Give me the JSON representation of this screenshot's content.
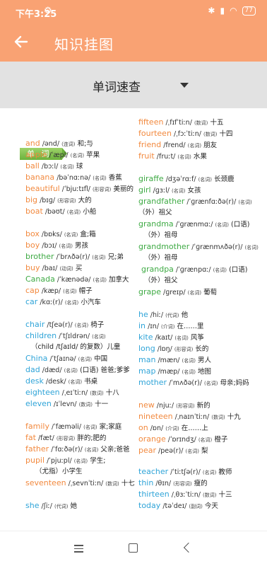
{
  "status": {
    "time": "下午3:25",
    "battery": "77"
  },
  "appbar": {
    "title": "知识挂图"
  },
  "selector": {
    "label": "单词速查"
  },
  "section_tag": "单 词",
  "columns": [
    [
      {
        "word": "and",
        "phon": "/ənd/",
        "pos": "(连词)",
        "meaning": "和;与",
        "color": "orange"
      },
      {
        "word": "apple",
        "phon": "/ˈæpl/",
        "pos": "(名词)",
        "meaning": "苹果",
        "color": "orange"
      },
      {
        "word": "ball",
        "phon": "/bɔːl/",
        "pos": "(名词)",
        "meaning": "球",
        "color": "orange"
      },
      {
        "word": "banana",
        "phon": "/bəˈnɑːnə/",
        "pos": "(名词)",
        "meaning": "香蕉",
        "color": "orange"
      },
      {
        "word": "beautiful",
        "phon": "/ˈbjuːtɪfl/",
        "pos": "(形容词)",
        "meaning": "美丽的",
        "color": "orange"
      },
      {
        "word": "big",
        "phon": "/bɪɡ/",
        "pos": "(形容词)",
        "meaning": "大的",
        "color": "orange"
      },
      {
        "word": "boat",
        "phon": "/bəʊt/",
        "pos": "(名词)",
        "meaning": "小船",
        "color": "orange"
      },
      {
        "word": "box",
        "phon": "/bɒks/",
        "pos": "(名词)",
        "meaning": "盒;箱",
        "color": "orange"
      },
      {
        "word": "boy",
        "phon": "/bɔɪ/",
        "pos": "(名词)",
        "meaning": "男孩",
        "color": "orange"
      },
      {
        "word": "brother",
        "phon": "/ˈbrʌðə(r)/",
        "pos": "(名词)",
        "meaning": "兄;弟",
        "color": "green"
      },
      {
        "word": "buy",
        "phon": "/baɪ/",
        "pos": "(动词)",
        "meaning": "买",
        "color": "orange"
      },
      {
        "word": "Canada",
        "phon": "/ˈkænədə/",
        "pos": "(名词)",
        "meaning": "加拿大",
        "color": "green"
      },
      {
        "word": "cap",
        "phon": "/kæp/",
        "pos": "(名词)",
        "meaning": "帽子",
        "color": "orange"
      },
      {
        "word": "car",
        "phon": "/kɑː(r)/",
        "pos": "(名词)",
        "meaning": "小汽车",
        "color": "blue"
      },
      {
        "word": "chair",
        "phon": "/tʃeə(r)/",
        "pos": "(名词)",
        "meaning": "椅子",
        "color": "blue"
      },
      {
        "word": "children",
        "phon": "/ˈtʃɪldrən/",
        "pos": "(名词)",
        "meaning": "",
        "color": "blue"
      },
      {
        "word": "",
        "phon": "",
        "pos": "",
        "meaning": "（child /tʃaɪld/ 的复数）儿童",
        "color": "blue"
      },
      {
        "word": "China",
        "phon": "/ˈtʃaɪnə/",
        "pos": "(名词)",
        "meaning": "中国",
        "color": "blue"
      },
      {
        "word": "dad",
        "phon": "/dæd/",
        "pos": "(名词)",
        "meaning": "(口语) 爸爸;爹爹",
        "color": "blue"
      },
      {
        "word": "desk",
        "phon": "/desk/",
        "pos": "(名词)",
        "meaning": "书桌",
        "color": "blue"
      },
      {
        "word": "eighteen",
        "phon": "/ˌeɪˈtiːn/",
        "pos": "(数词)",
        "meaning": "十八",
        "color": "blue"
      },
      {
        "word": "eleven",
        "phon": "/ɪˈlevn/",
        "pos": "(数词)",
        "meaning": "十一",
        "color": "blue"
      },
      {
        "word": "family",
        "phon": "/ˈfæməli/",
        "pos": "(名词)",
        "meaning": "家;家庭",
        "color": "orange"
      },
      {
        "word": "fat",
        "phon": "/fæt/",
        "pos": "(形容词)",
        "meaning": "胖的;肥的",
        "color": "orange"
      },
      {
        "word": "father",
        "phon": "/ˈfɑːðə(r)/",
        "pos": "(名词)",
        "meaning": "父亲;爸爸",
        "color": "orange"
      },
      {
        "word": "pupil",
        "phon": "/ˈpjuːpl/",
        "pos": "(名词)",
        "meaning": "学生;",
        "color": "orange"
      },
      {
        "word": "",
        "phon": "",
        "pos": "",
        "meaning": "（尤指）小学生",
        "color": "orange"
      },
      {
        "word": "seventeen",
        "phon": "/ˌsevnˈtiːn/",
        "pos": "(数词)",
        "meaning": "十七",
        "color": "orange"
      },
      {
        "word": "she",
        "phon": "/ʃiː/",
        "pos": "(代词)",
        "meaning": "她",
        "color": "blue"
      }
    ],
    [
      {
        "word": "fifteen",
        "phon": "/ˌfɪfˈtiːn/",
        "pos": "(数词)",
        "meaning": "十五",
        "color": "orange"
      },
      {
        "word": "fourteen",
        "phon": "/ˌfɔːˈtiːn/",
        "pos": "(数词)",
        "meaning": "十四",
        "color": "orange"
      },
      {
        "word": "friend",
        "phon": "/frend/",
        "pos": "(名词)",
        "meaning": "朋友",
        "color": "orange"
      },
      {
        "word": "fruit",
        "phon": "/fruːt/",
        "pos": "(名词)",
        "meaning": "水果",
        "color": "orange"
      },
      {
        "word": "giraffe",
        "phon": "/dʒəˈrɑːf/",
        "pos": "(名词)",
        "meaning": "长颈鹿",
        "color": "green"
      },
      {
        "word": "girl",
        "phon": "/ɡɜːl/",
        "pos": "(名词)",
        "meaning": "女孩",
        "color": "green"
      },
      {
        "word": "grandfather",
        "phon": "/ˈɡrænfɑːðə(r)/",
        "pos": "(名词)",
        "meaning": "",
        "color": "green"
      },
      {
        "word": "",
        "phon": "",
        "pos": "",
        "meaning": "（外）祖父",
        "color": "green"
      },
      {
        "word": "grandma",
        "phon": "/ˈɡrænmɑː/",
        "pos": "(名词)",
        "meaning": "(口语)",
        "color": "green"
      },
      {
        "word": "",
        "phon": "",
        "pos": "",
        "meaning": "（外）祖母",
        "color": "green"
      },
      {
        "word": "grandmother",
        "phon": "/ˈɡrænmʌðə(r)/",
        "pos": "(名词)",
        "meaning": "",
        "color": "green"
      },
      {
        "word": "",
        "phon": "",
        "pos": "",
        "meaning": "（外）祖母",
        "color": "green"
      },
      {
        "word": "grandpa",
        "phon": "/ˈɡrænpɑː/",
        "pos": "(名词)",
        "meaning": "(口语)",
        "color": "green"
      },
      {
        "word": "",
        "phon": "",
        "pos": "",
        "meaning": "（外）祖父",
        "color": "green"
      },
      {
        "word": "grape",
        "phon": "/ɡreɪp/",
        "pos": "(名词)",
        "meaning": "葡萄",
        "color": "green"
      },
      {
        "word": "he",
        "phon": "/hiː/",
        "pos": "(代词)",
        "meaning": "他",
        "color": "blue"
      },
      {
        "word": "in",
        "phon": "/ɪn/",
        "pos": "(介词)",
        "meaning": "在……里",
        "color": "blue"
      },
      {
        "word": "kite",
        "phon": "/kaɪt/",
        "pos": "(名词)",
        "meaning": "风筝",
        "color": "blue"
      },
      {
        "word": "long",
        "phon": "/lɒŋ/",
        "pos": "(形容词)",
        "meaning": "长的",
        "color": "blue"
      },
      {
        "word": "man",
        "phon": "/mæn/",
        "pos": "(名词)",
        "meaning": "男人",
        "color": "blue"
      },
      {
        "word": "map",
        "phon": "/mæp/",
        "pos": "(名词)",
        "meaning": "地图",
        "color": "blue"
      },
      {
        "word": "mother",
        "phon": "/ˈmʌðə(r)/",
        "pos": "(名词)",
        "meaning": "母亲;妈妈",
        "color": "blue"
      },
      {
        "word": "new",
        "phon": "/njuː/",
        "pos": "(形容词)",
        "meaning": "新的",
        "color": "orange"
      },
      {
        "word": "nineteen",
        "phon": "/ˌnaɪnˈtiːn/",
        "pos": "(数词)",
        "meaning": "十九",
        "color": "orange"
      },
      {
        "word": "on",
        "phon": "/ɒn/",
        "pos": "(介词)",
        "meaning": "在……上",
        "color": "orange"
      },
      {
        "word": "orange",
        "phon": "/ˈɒrɪndʒ/",
        "pos": "(名词)",
        "meaning": "橙子",
        "color": "orange"
      },
      {
        "word": "pear",
        "phon": "/peə(r)/",
        "pos": "(名词)",
        "meaning": "梨",
        "color": "orange"
      },
      {
        "word": "teacher",
        "phon": "/ˈtiːtʃə(r)/",
        "pos": "(名词)",
        "meaning": "教师",
        "color": "blue"
      },
      {
        "word": "thin",
        "phon": "/θɪn/",
        "pos": "(形容词)",
        "meaning": "瘦的",
        "color": "blue"
      },
      {
        "word": "thirteen",
        "phon": "/ˌθɜːˈtiːn/",
        "pos": "(数词)",
        "meaning": "十三",
        "color": "blue"
      },
      {
        "word": "today",
        "phon": "/təˈdeɪ/",
        "pos": "(副词)",
        "meaning": "今天",
        "color": "blue"
      }
    ]
  ],
  "colors": {
    "accent": "#F9A273",
    "selector_bg": "#E2E2E2",
    "tag_green": "#7BBE45",
    "word_orange": "#F2893E",
    "word_green": "#3EAA44",
    "word_blue": "#2FA4D8"
  }
}
